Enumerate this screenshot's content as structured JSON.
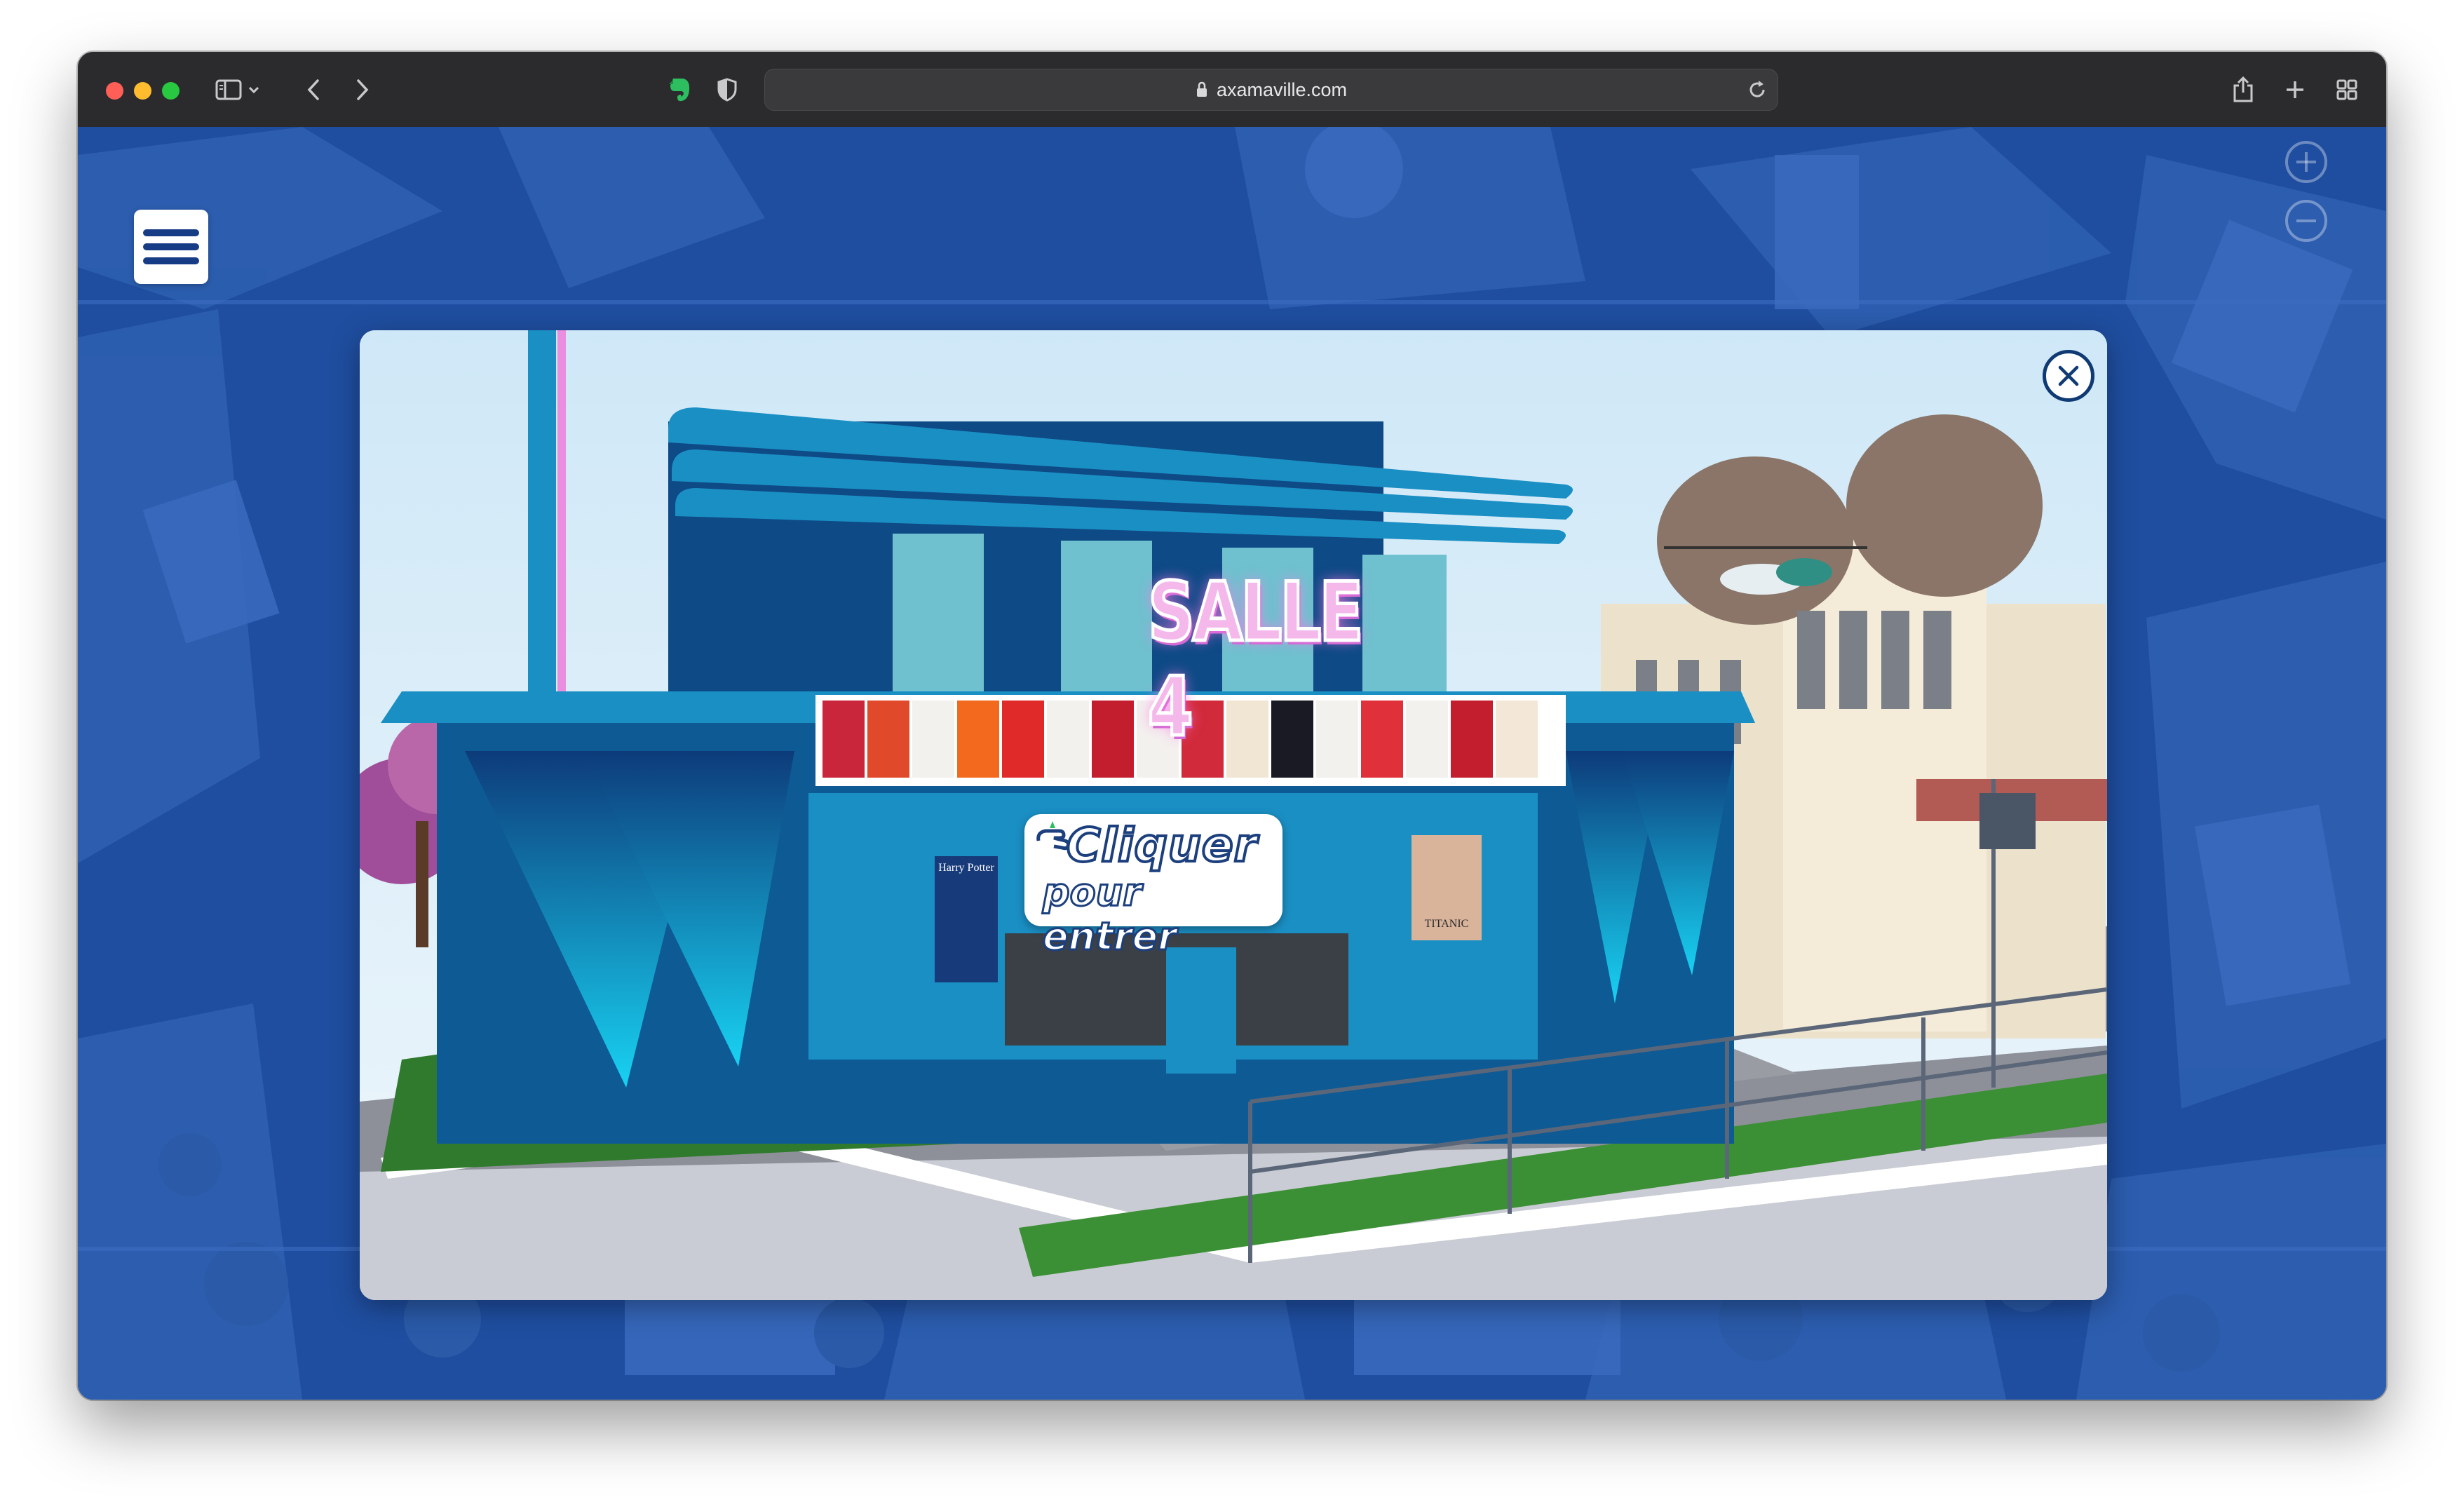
{
  "browser": {
    "url": "axamaville.com",
    "traffic_lights": [
      "#ff5f57",
      "#febc2e",
      "#28c840"
    ]
  },
  "page": {
    "menu_label": "menu",
    "background_color": "#1f4ea0"
  },
  "modal": {
    "sign_text": "SALLE 4",
    "cta_line1": "Cliquer",
    "cta_line2": "pour entrer",
    "poster_left_title": "Harry Potter",
    "poster_right_title": "TITANIC",
    "close_icon": "close-icon"
  },
  "colors": {
    "theater_blue": "#0e4a86",
    "theater_teal": "#1a8fc4",
    "sign_pink": "#f4b8ea",
    "cta_text": "#1c3f7e"
  }
}
